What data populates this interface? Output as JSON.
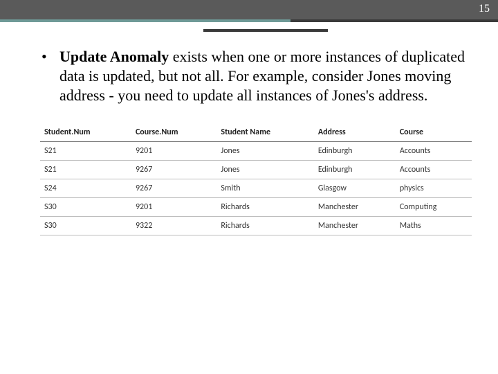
{
  "header": {
    "page_number": "15"
  },
  "body": {
    "term": "Update Anomaly",
    "text_after": " exists when one or more instances of duplicated data is updated, but not all. For example, consider Jones moving address - you need to update all instances of Jones's address."
  },
  "chart_data": {
    "type": "table",
    "columns": [
      "Student.Num",
      "Course.Num",
      "Student Name",
      "Address",
      "Course"
    ],
    "rows": [
      [
        "S21",
        "9201",
        "Jones",
        "Edinburgh",
        "Accounts"
      ],
      [
        "S21",
        "9267",
        "Jones",
        "Edinburgh",
        "Accounts"
      ],
      [
        "S24",
        "9267",
        "Smith",
        "Glasgow",
        "physics"
      ],
      [
        "S30",
        "9201",
        "Richards",
        "Manchester",
        "Computing"
      ],
      [
        "S30",
        "9322",
        "Richards",
        "Manchester",
        "Maths"
      ]
    ]
  }
}
